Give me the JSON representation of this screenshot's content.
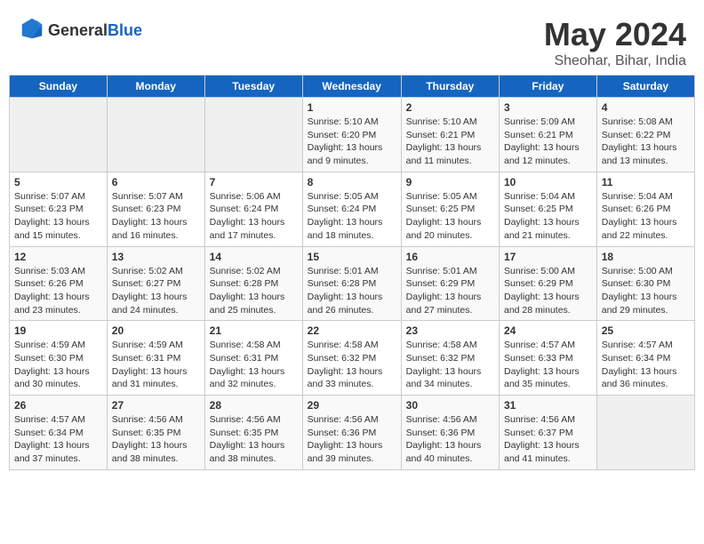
{
  "header": {
    "logo_line1": "General",
    "logo_line2": "Blue",
    "title": "May 2024",
    "location": "Sheohar, Bihar, India"
  },
  "weekdays": [
    "Sunday",
    "Monday",
    "Tuesday",
    "Wednesday",
    "Thursday",
    "Friday",
    "Saturday"
  ],
  "weeks": [
    [
      {
        "day": "",
        "info": ""
      },
      {
        "day": "",
        "info": ""
      },
      {
        "day": "",
        "info": ""
      },
      {
        "day": "1",
        "info": "Sunrise: 5:10 AM\nSunset: 6:20 PM\nDaylight: 13 hours\nand 9 minutes."
      },
      {
        "day": "2",
        "info": "Sunrise: 5:10 AM\nSunset: 6:21 PM\nDaylight: 13 hours\nand 11 minutes."
      },
      {
        "day": "3",
        "info": "Sunrise: 5:09 AM\nSunset: 6:21 PM\nDaylight: 13 hours\nand 12 minutes."
      },
      {
        "day": "4",
        "info": "Sunrise: 5:08 AM\nSunset: 6:22 PM\nDaylight: 13 hours\nand 13 minutes."
      }
    ],
    [
      {
        "day": "5",
        "info": "Sunrise: 5:07 AM\nSunset: 6:23 PM\nDaylight: 13 hours\nand 15 minutes."
      },
      {
        "day": "6",
        "info": "Sunrise: 5:07 AM\nSunset: 6:23 PM\nDaylight: 13 hours\nand 16 minutes."
      },
      {
        "day": "7",
        "info": "Sunrise: 5:06 AM\nSunset: 6:24 PM\nDaylight: 13 hours\nand 17 minutes."
      },
      {
        "day": "8",
        "info": "Sunrise: 5:05 AM\nSunset: 6:24 PM\nDaylight: 13 hours\nand 18 minutes."
      },
      {
        "day": "9",
        "info": "Sunrise: 5:05 AM\nSunset: 6:25 PM\nDaylight: 13 hours\nand 20 minutes."
      },
      {
        "day": "10",
        "info": "Sunrise: 5:04 AM\nSunset: 6:25 PM\nDaylight: 13 hours\nand 21 minutes."
      },
      {
        "day": "11",
        "info": "Sunrise: 5:04 AM\nSunset: 6:26 PM\nDaylight: 13 hours\nand 22 minutes."
      }
    ],
    [
      {
        "day": "12",
        "info": "Sunrise: 5:03 AM\nSunset: 6:26 PM\nDaylight: 13 hours\nand 23 minutes."
      },
      {
        "day": "13",
        "info": "Sunrise: 5:02 AM\nSunset: 6:27 PM\nDaylight: 13 hours\nand 24 minutes."
      },
      {
        "day": "14",
        "info": "Sunrise: 5:02 AM\nSunset: 6:28 PM\nDaylight: 13 hours\nand 25 minutes."
      },
      {
        "day": "15",
        "info": "Sunrise: 5:01 AM\nSunset: 6:28 PM\nDaylight: 13 hours\nand 26 minutes."
      },
      {
        "day": "16",
        "info": "Sunrise: 5:01 AM\nSunset: 6:29 PM\nDaylight: 13 hours\nand 27 minutes."
      },
      {
        "day": "17",
        "info": "Sunrise: 5:00 AM\nSunset: 6:29 PM\nDaylight: 13 hours\nand 28 minutes."
      },
      {
        "day": "18",
        "info": "Sunrise: 5:00 AM\nSunset: 6:30 PM\nDaylight: 13 hours\nand 29 minutes."
      }
    ],
    [
      {
        "day": "19",
        "info": "Sunrise: 4:59 AM\nSunset: 6:30 PM\nDaylight: 13 hours\nand 30 minutes."
      },
      {
        "day": "20",
        "info": "Sunrise: 4:59 AM\nSunset: 6:31 PM\nDaylight: 13 hours\nand 31 minutes."
      },
      {
        "day": "21",
        "info": "Sunrise: 4:58 AM\nSunset: 6:31 PM\nDaylight: 13 hours\nand 32 minutes."
      },
      {
        "day": "22",
        "info": "Sunrise: 4:58 AM\nSunset: 6:32 PM\nDaylight: 13 hours\nand 33 minutes."
      },
      {
        "day": "23",
        "info": "Sunrise: 4:58 AM\nSunset: 6:32 PM\nDaylight: 13 hours\nand 34 minutes."
      },
      {
        "day": "24",
        "info": "Sunrise: 4:57 AM\nSunset: 6:33 PM\nDaylight: 13 hours\nand 35 minutes."
      },
      {
        "day": "25",
        "info": "Sunrise: 4:57 AM\nSunset: 6:34 PM\nDaylight: 13 hours\nand 36 minutes."
      }
    ],
    [
      {
        "day": "26",
        "info": "Sunrise: 4:57 AM\nSunset: 6:34 PM\nDaylight: 13 hours\nand 37 minutes."
      },
      {
        "day": "27",
        "info": "Sunrise: 4:56 AM\nSunset: 6:35 PM\nDaylight: 13 hours\nand 38 minutes."
      },
      {
        "day": "28",
        "info": "Sunrise: 4:56 AM\nSunset: 6:35 PM\nDaylight: 13 hours\nand 38 minutes."
      },
      {
        "day": "29",
        "info": "Sunrise: 4:56 AM\nSunset: 6:36 PM\nDaylight: 13 hours\nand 39 minutes."
      },
      {
        "day": "30",
        "info": "Sunrise: 4:56 AM\nSunset: 6:36 PM\nDaylight: 13 hours\nand 40 minutes."
      },
      {
        "day": "31",
        "info": "Sunrise: 4:56 AM\nSunset: 6:37 PM\nDaylight: 13 hours\nand 41 minutes."
      },
      {
        "day": "",
        "info": ""
      }
    ]
  ]
}
